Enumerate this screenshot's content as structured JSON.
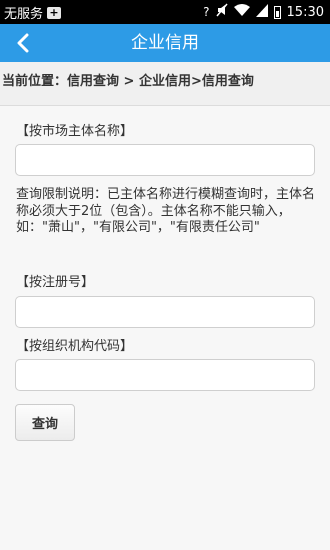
{
  "status_bar": {
    "carrier": "无服务",
    "plus_icon": "plus-icon",
    "time": "15:30",
    "icons": [
      "question-icon",
      "mute-icon",
      "wifi-icon",
      "signal-icon",
      "battery-icon"
    ]
  },
  "header": {
    "title": "企业信用",
    "back_icon": "chevron-left-icon",
    "background": "#2d9be6"
  },
  "location": {
    "text": "当前位置：信用查询 > 企业信用>信用查询"
  },
  "form": {
    "name_label": "【按市场主体名称】",
    "name_value": "",
    "note": "查询限制说明：已主体名称进行模糊查询时，主体名称必须大于2位（包含）。主体名称不能只输入，如：\"萧山\"，\"有限公司\"，\"有限责任公司\"",
    "reg_label": "【按注册号】",
    "reg_value": "",
    "org_label": "【按组织机构代码】",
    "org_value": "",
    "submit_label": "查询"
  }
}
